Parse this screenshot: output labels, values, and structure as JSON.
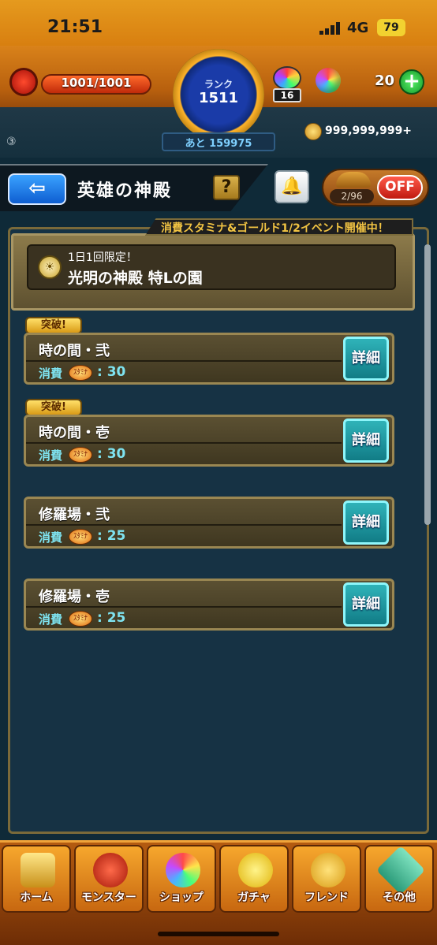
{
  "status": {
    "time": "21:51",
    "network": "4G",
    "battery": "79"
  },
  "header": {
    "stamina": "1001/1001",
    "rank_label": "ランク",
    "rank_value": "1511",
    "rank_next": "あと 159975",
    "lucky_count": "16",
    "orb_count": "20",
    "orb_add": "+",
    "gold": "999,999,999+",
    "notice_num": "③"
  },
  "titlebar": {
    "back": "⇦",
    "title": "英雄の神殿",
    "help": "?",
    "toggle_count": "2/96",
    "toggle_state": "OFF"
  },
  "event_banner": "消費スタミナ&ゴールド1/2イベント開催中！",
  "featured": {
    "note": "1日1回限定！",
    "title": "光明の神殿 特Lの園"
  },
  "quests": [
    {
      "badge": "突破!",
      "name": "時の間・弐",
      "cost_label": "消費",
      "stamina_icon_text": "ｽﾀﾐﾅ",
      "cost": ": 30",
      "detail": "詳細"
    },
    {
      "badge": "突破!",
      "name": "時の間・壱",
      "cost_label": "消費",
      "stamina_icon_text": "ｽﾀﾐﾅ",
      "cost": ": 30",
      "detail": "詳細"
    },
    {
      "badge": "",
      "name": "修羅場・弐",
      "cost_label": "消費",
      "stamina_icon_text": "ｽﾀﾐﾅ",
      "cost": ": 25",
      "detail": "詳細"
    },
    {
      "badge": "",
      "name": "修羅場・壱",
      "cost_label": "消費",
      "stamina_icon_text": "ｽﾀﾐﾅ",
      "cost": ": 25",
      "detail": "詳細"
    }
  ],
  "nav": [
    {
      "label": "ホーム",
      "icon": "home-icon"
    },
    {
      "label": "モンスター",
      "icon": "monster-icon"
    },
    {
      "label": "ショップ",
      "icon": "shop-orb-icon"
    },
    {
      "label": "ガチャ",
      "icon": "gacha-icon"
    },
    {
      "label": "フレンド",
      "icon": "friend-icon"
    },
    {
      "label": "その他",
      "icon": "other-icon"
    }
  ]
}
